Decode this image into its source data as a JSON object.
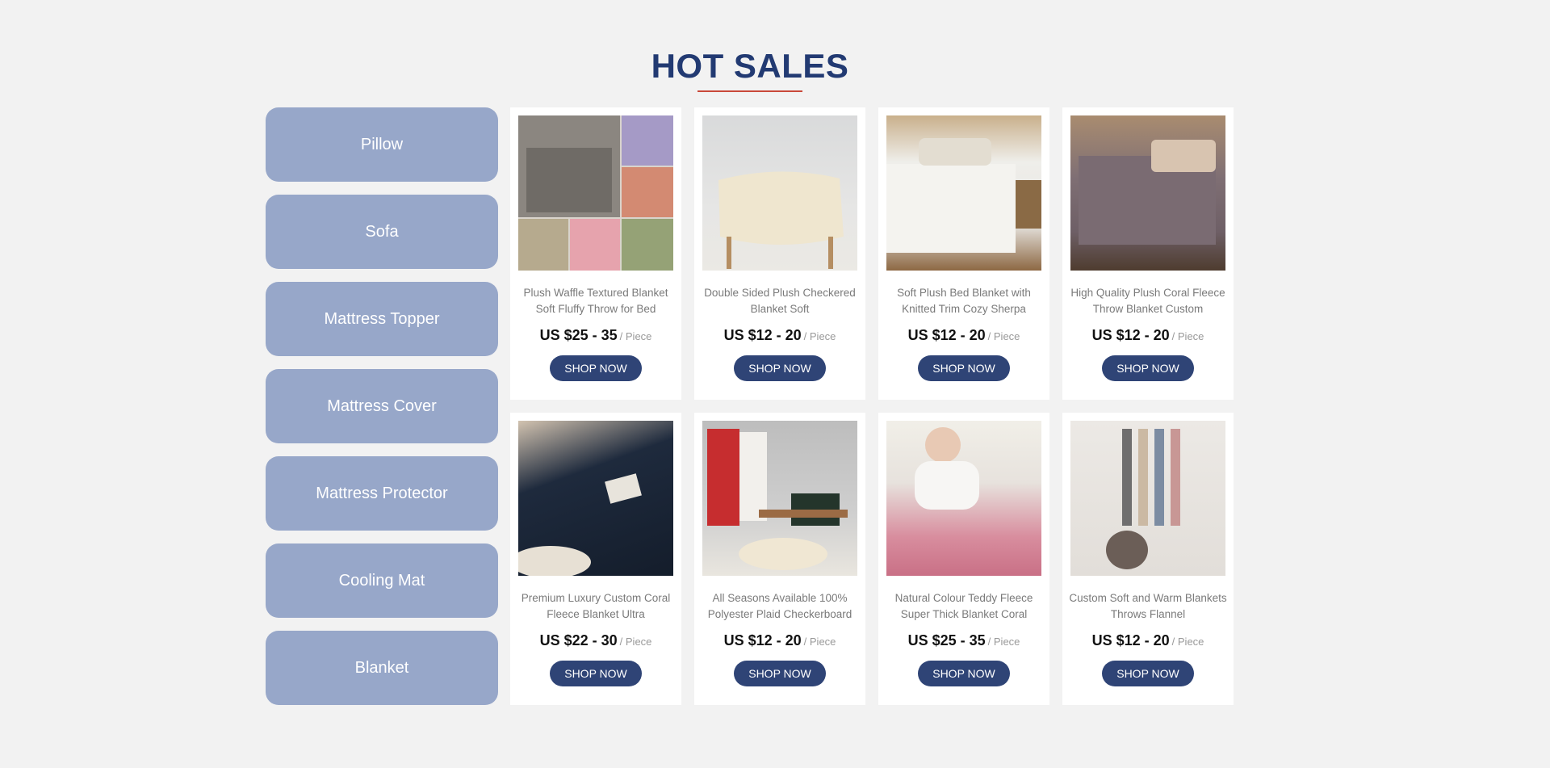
{
  "section": {
    "title": "HOT SALES"
  },
  "categories": [
    {
      "label": "Pillow"
    },
    {
      "label": "Sofa"
    },
    {
      "label": "Mattress Topper"
    },
    {
      "label": "Mattress Cover"
    },
    {
      "label": "Mattress Protector"
    },
    {
      "label": "Cooling Mat"
    },
    {
      "label": "Blanket"
    }
  ],
  "products": [
    {
      "name": "Plush Waffle Textured Blanket Soft Fluffy Throw for Bed",
      "price": "US $25 - 35",
      "unit": "/ Piece",
      "button": "SHOP NOW",
      "image": "blanket-collage-photo"
    },
    {
      "name": "Double Sided Plush Checkered Blanket Soft",
      "price": "US $12 - 20",
      "unit": "/ Piece",
      "button": "SHOP NOW",
      "image": "cream-blanket-on-chair-photo"
    },
    {
      "name": "Soft Plush Bed Blanket with Knitted Trim Cozy Sherpa",
      "price": "US $12 - 20",
      "unit": "/ Piece",
      "button": "SHOP NOW",
      "image": "white-bed-blanket-photo"
    },
    {
      "name": "High Quality Plush Coral Fleece Throw Blanket Custom",
      "price": "US $12 - 20",
      "unit": "/ Piece",
      "button": "SHOP NOW",
      "image": "purple-bed-blanket-photo"
    },
    {
      "name": "Premium Luxury Custom Coral Fleece Blanket Ultra",
      "price": "US $22 - 30",
      "unit": "/ Piece",
      "button": "SHOP NOW",
      "image": "navy-fleece-blanket-photo"
    },
    {
      "name": "All Seasons Available 100% Polyester Plaid Checkerboard",
      "price": "US $12 - 20",
      "unit": "/ Piece",
      "button": "SHOP NOW",
      "image": "blankets-on-bench-photo"
    },
    {
      "name": "Natural Colour Teddy Fleece Super Thick Blanket Coral",
      "price": "US $25 - 35",
      "unit": "/ Piece",
      "button": "SHOP NOW",
      "image": "pink-teddy-blanket-photo"
    },
    {
      "name": "Custom Soft and Warm Blankets Throws Flannel",
      "price": "US $12 - 20",
      "unit": "/ Piece",
      "button": "SHOP NOW",
      "image": "hanging-throws-photo"
    }
  ]
}
